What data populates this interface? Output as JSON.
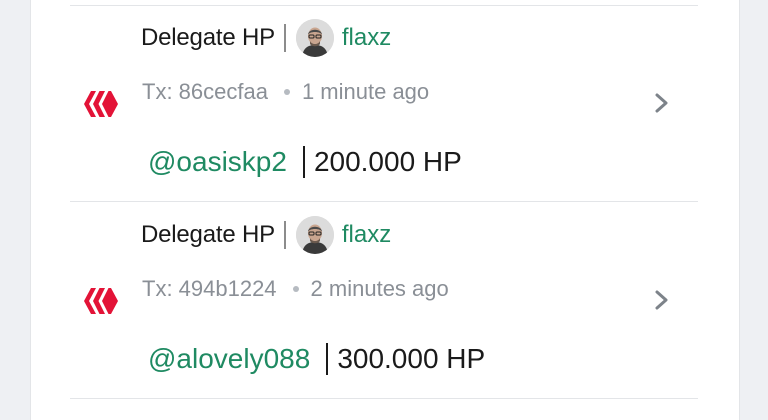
{
  "colors": {
    "hive_red": "#e31337",
    "link_green": "#1f8a62",
    "muted_gray": "#8a8f96"
  },
  "transactions": [
    {
      "operation": "Delegate HP",
      "user": "flaxz",
      "tx_label": "Tx: 86cecfaa",
      "time_ago": "1 minute ago",
      "recipient": "@oasiskp2",
      "amount": "200.000 HP",
      "icon": "hive-icon"
    },
    {
      "operation": "Delegate HP",
      "user": "flaxz",
      "tx_label": "Tx: 494b1224",
      "time_ago": "2 minutes ago",
      "recipient": "@alovely088",
      "amount": "300.000 HP",
      "icon": "hive-icon"
    }
  ]
}
